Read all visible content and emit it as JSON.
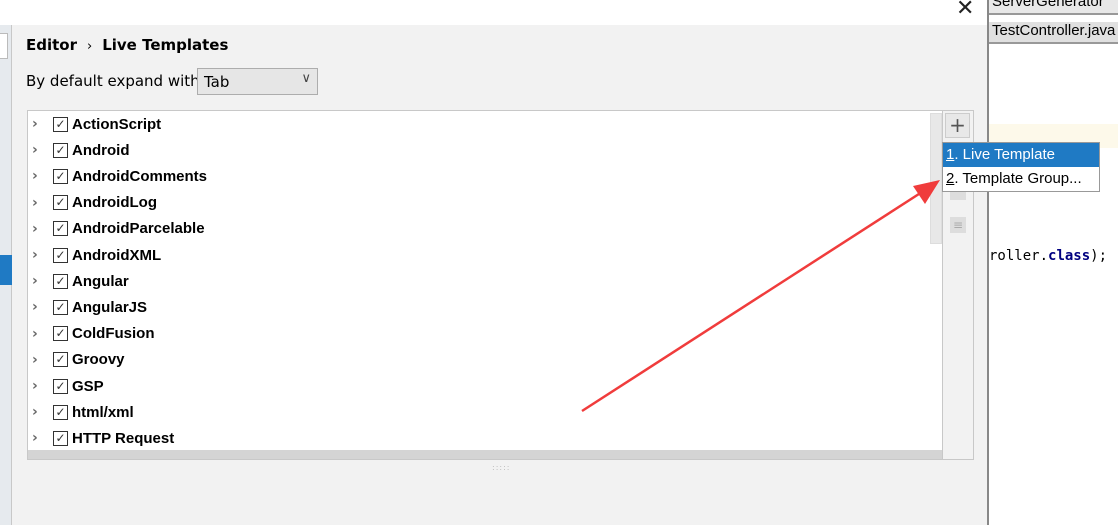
{
  "breadcrumb": {
    "parent": "Editor",
    "separator": "›",
    "current": "Live Templates"
  },
  "expand": {
    "label": "By default expand with",
    "value": "Tab"
  },
  "tree_items": [
    {
      "label": "ActionScript",
      "checked": true
    },
    {
      "label": "Android",
      "checked": true
    },
    {
      "label": "AndroidComments",
      "checked": true
    },
    {
      "label": "AndroidLog",
      "checked": true
    },
    {
      "label": "AndroidParcelable",
      "checked": true
    },
    {
      "label": "AndroidXML",
      "checked": true
    },
    {
      "label": "Angular",
      "checked": true
    },
    {
      "label": "AngularJS",
      "checked": true
    },
    {
      "label": "ColdFusion",
      "checked": true
    },
    {
      "label": "Groovy",
      "checked": true
    },
    {
      "label": "GSP",
      "checked": true
    },
    {
      "label": "html/xml",
      "checked": true
    },
    {
      "label": "HTTP Request",
      "checked": true
    }
  ],
  "popup": {
    "items": [
      {
        "mnemonic": "1",
        "label": ". Live Template",
        "selected": true
      },
      {
        "mnemonic": "2",
        "label": ". Template Group...",
        "selected": false
      }
    ]
  },
  "editor": {
    "tabs": [
      "ServerGenerator",
      "TestController.java"
    ],
    "code_prefix": "roller.",
    "code_keyword": "class",
    "code_suffix": ");"
  },
  "colors": {
    "accent": "#1f7ac4",
    "annotation_arrow": "#f03c3c"
  }
}
